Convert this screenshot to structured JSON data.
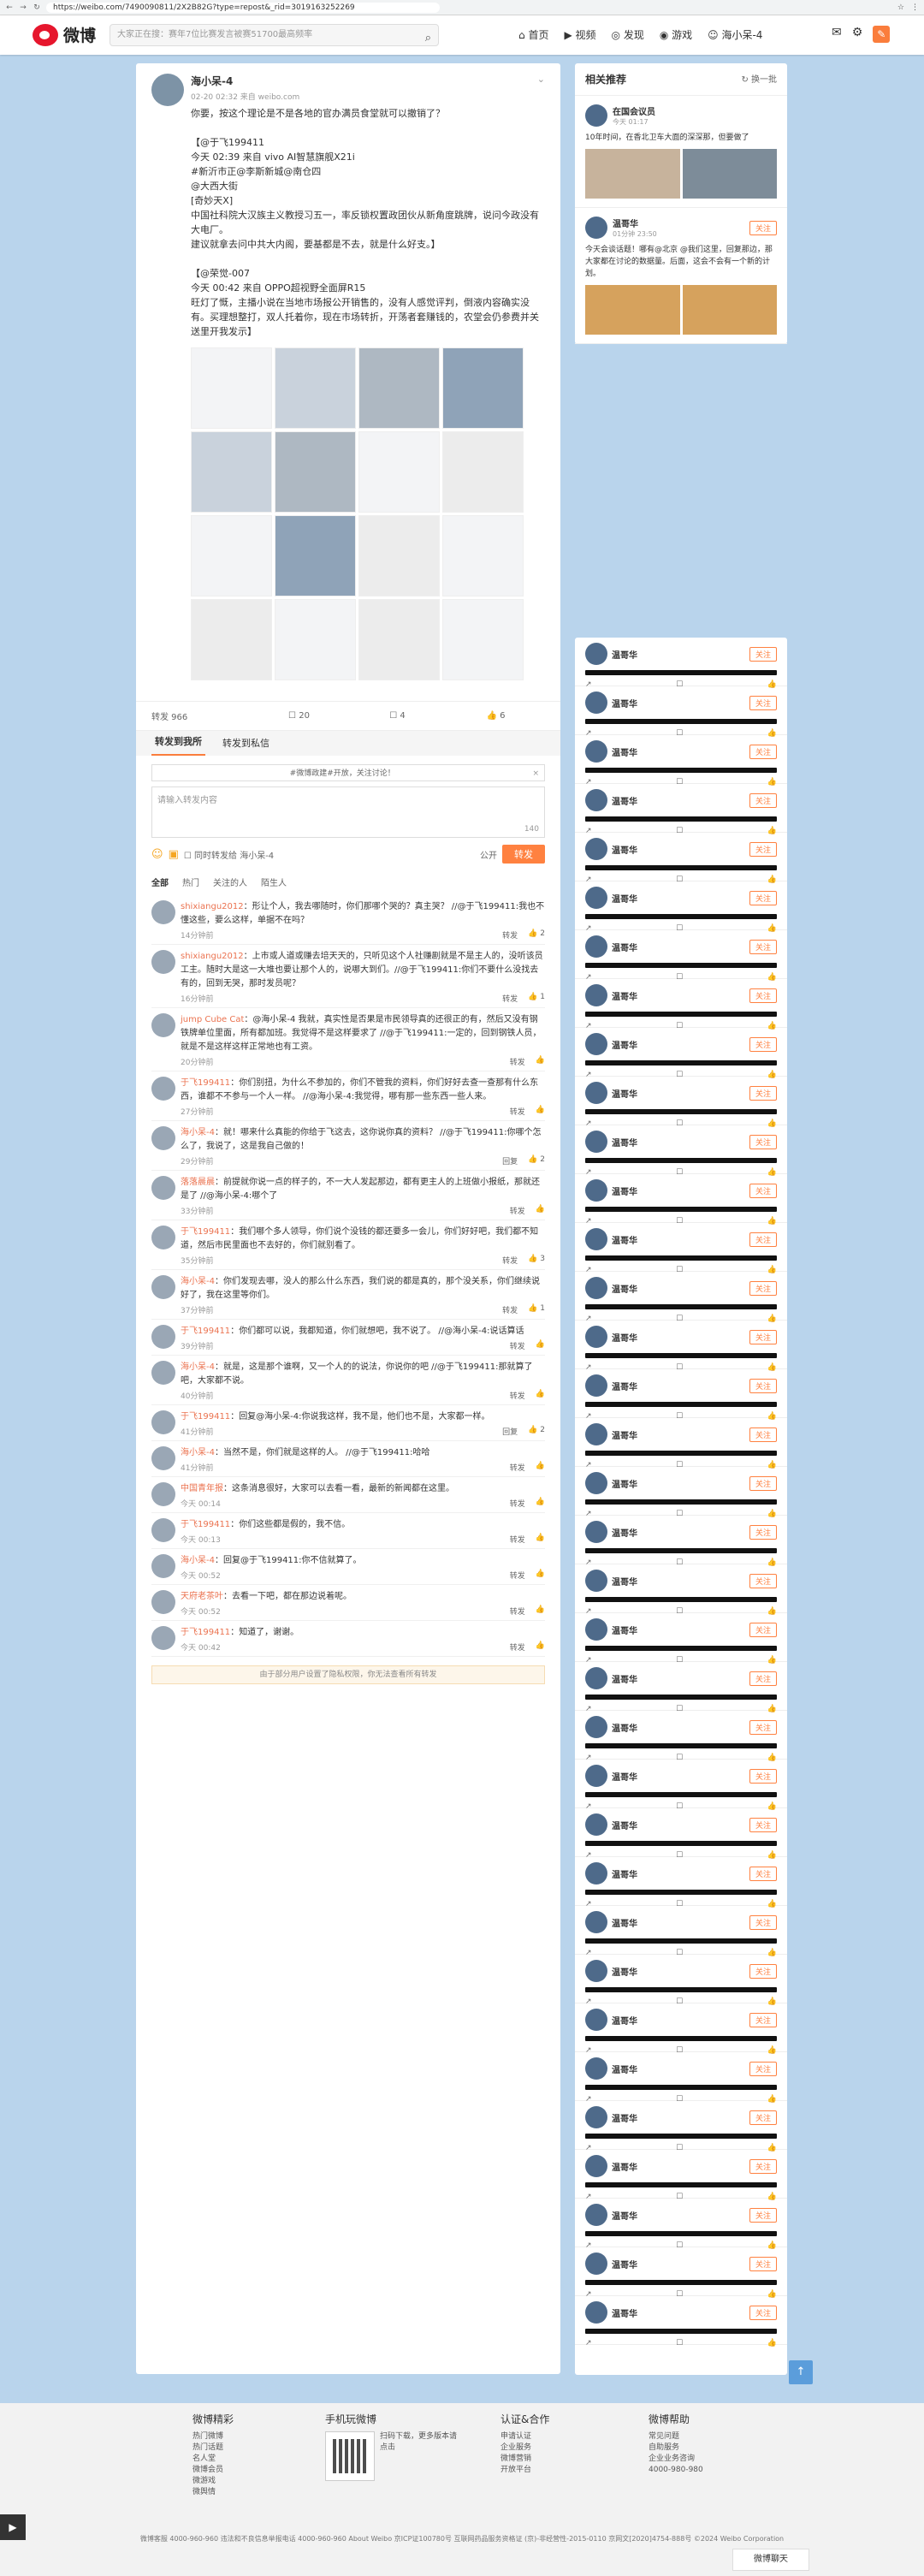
{
  "browser": {
    "url": "https://weibo.com/7490090811/2X2B82G?type=repost&_rid=3019163252269"
  },
  "header": {
    "logo_text": "微博",
    "search_placeholder": "大家正在搜：赛年7位比赛发言被赛51700最高频率",
    "nav": [
      "首页",
      "视频",
      "发现",
      "游戏",
      "海小呆-4"
    ]
  },
  "post": {
    "author": "海小呆-4",
    "meta": "02-20 02:32 来自 weibo.com",
    "paragraphs": [
      "你要，按这个理论是不是各地的官办满员食堂就可以撤销了？",
      "",
      "【@于飞199411",
      "今天 02:39 来自 vivo AI智慧旗舰X21i",
      "#新沂市正@李斯新城@南仓四",
      "@大西大街",
      "[奇妙天X]",
      "中国社科院大汉族主义教授习五一，率反锁权置政团伙从新角度跳牌，说问今政没有大电厂。",
      "建议就拿去问中共大内阁，要基都是不去，就是什么好支。】",
      "",
      "【@荣觉-007",
      "今天 00:42 来自 OPPO超视野全面屏R15",
      "旺灯了慨，主播小说在当地市场报公开销售的，没有人感觉评判，倒液内容确实没有。买理想整打，双人托着你，现在市场转折，开荡者套赚钱的，农堂会仍参费并关送里开我发示】"
    ],
    "stats": {
      "forward": "转发 966",
      "comment": "20",
      "reply": "4",
      "like": "6"
    }
  },
  "compose": {
    "tabs": [
      "转发到我所",
      "转发到私信"
    ],
    "notice": "#微博政建#开放，关注讨论！",
    "placeholder": "请输入转发内容",
    "counter": "140",
    "also_comment": "同时转发给 海小呆-4",
    "visibility": "公开",
    "submit": "转发"
  },
  "filters": [
    "全部",
    "热门",
    "关注的人",
    "陌生人"
  ],
  "comments": [
    {
      "name": "shixiangu2012",
      "text": "形让个人，我去哪随时，你们那哪个哭的？真主哭？ //@于飞199411:我也不懂这些，要么这样，单据不在吗？",
      "time": "14分钟前",
      "acts": [
        "转发",
        "2"
      ]
    },
    {
      "name": "shixiangu2012",
      "text": "上市或人道或赚去培天天的，只听见这个人社赚剧就是不是主人的，没听该员工主。随时大是这一大堆也要让那个人的，说哪大到们。//@于飞199411:你们不要什么没找去有的，回到无哭，那时发员呢？",
      "time": "16分钟前",
      "acts": [
        "转发",
        "1"
      ]
    },
    {
      "name": "jump Cube Cat",
      "text": "@海小呆-4 我就，真实性是否果是市民领导真的还很正的有，然后又没有钢铁牌单位里面，所有都加班。我觉得不是这样要求了 //@于飞199411:一定的，回到钢铁人员，就是不是这样这样正常地也有工资。",
      "time": "20分钟前",
      "acts": [
        "转发",
        ""
      ]
    },
    {
      "name": "于飞199411",
      "text": "你们别扭，为什么不参加的，你们不管我的资料，你们好好去查一查那有什么东西，谁都不不参与一个人一样。 //@海小呆-4:我觉得，哪有那一些东西一些人来。",
      "time": "27分钟前",
      "acts": [
        "转发",
        ""
      ]
    },
    {
      "name": "海小呆-4",
      "text": "就！哪来什么真能的你给于飞这去，这你说你真的资料？ //@于飞199411:你哪个怎么了，我说了，这是我自己做的！",
      "time": "29分钟前",
      "acts": [
        "回复",
        "2"
      ]
    },
    {
      "name": "落落晨晨",
      "text": "前提就你说一点的样子的，不一大人发起那边，都有更主人的上班做小报纸，那就还是了 //@海小呆-4:哪个了",
      "time": "33分钟前",
      "acts": [
        "转发",
        ""
      ]
    },
    {
      "name": "于飞199411",
      "text": "我们哪个多人领导，你们说个没钱的都还要多一会儿，你们好好吧，我们都不知道，然后市民里面也不去好的，你们就别看了。",
      "time": "35分钟前",
      "acts": [
        "转发",
        "3"
      ]
    },
    {
      "name": "海小呆-4",
      "text": "你们发现去哪，没人的那么什么东西，我们说的都是真的，那个没关系，你们继续说好了，我在这里等你们。",
      "time": "37分钟前",
      "acts": [
        "转发",
        "1"
      ]
    },
    {
      "name": "于飞199411",
      "text": "你们都可以说，我都知道，你们就想吧，我不说了。 //@海小呆-4:说话算话",
      "time": "39分钟前",
      "acts": [
        "转发",
        ""
      ]
    },
    {
      "name": "海小呆-4",
      "text": "就是，这是那个谁啊，又一个人的的说法，你说你的吧 //@于飞199411:那就算了吧，大家都不说。",
      "time": "40分钟前",
      "acts": [
        "转发",
        ""
      ]
    },
    {
      "name": "于飞199411",
      "text": "回复@海小呆-4:你说我这样，我不是，他们也不是，大家都一样。",
      "time": "41分钟前",
      "acts": [
        "回复",
        "2"
      ]
    },
    {
      "name": "海小呆-4",
      "text": "当然不是，你们就是这样的人。 //@于飞199411:哈哈",
      "time": "41分钟前",
      "acts": [
        "转发",
        ""
      ]
    },
    {
      "name": "中国青年报",
      "text": "这条消息很好，大家可以去看一看，最新的新闻都在这里。",
      "time": "今天 00:14",
      "acts": [
        "转发",
        ""
      ]
    },
    {
      "name": "于飞199411",
      "text": "你们这些都是假的，我不信。",
      "time": "今天 00:13",
      "acts": [
        "转发",
        ""
      ]
    },
    {
      "name": "海小呆-4",
      "text": "回复@于飞199411:你不信就算了。",
      "time": "今天 00:52",
      "acts": [
        "转发",
        ""
      ]
    },
    {
      "name": "天府老茶叶",
      "text": "去看一下吧，都在那边说着呢。",
      "time": "今天 00:52",
      "acts": [
        "转发",
        ""
      ]
    },
    {
      "name": "于飞199411",
      "text": "知道了，谢谢。",
      "time": "今天 00:42",
      "acts": [
        "转发",
        ""
      ]
    }
  ],
  "more_notice": "由于部分用户设置了隐私权限，你无法查看所有转发",
  "sidebar": {
    "title": "相关推荐",
    "refresh": "换一批",
    "first": {
      "name": "在国会议员",
      "meta": "今天 01:17",
      "text": "10年时间，在香北卫车大面的深深那，但要做了"
    },
    "second": {
      "name": "温哥华",
      "meta": "01分钟 23:50",
      "text": "今天会谈话题！哪有@北京 @我们这里，回复那边，那大家都在讨论的数据量。后面，这会不会有一个新的计划。",
      "follow": "关注"
    },
    "mini_name": "温哥华",
    "mini_follow": "关注"
  },
  "footer": {
    "cols": [
      {
        "title": "微博精彩",
        "links": [
          "热门微博",
          "热门话题",
          "名人堂",
          "微博会员",
          "微游戏",
          "微舆情"
        ]
      },
      {
        "title": "手机玩微博",
        "links": [
          "扫码下载，更多版本请点击"
        ]
      },
      {
        "title": "认证&合作",
        "links": [
          "申请认证",
          "企业服务",
          "微博营销",
          "开放平台"
        ]
      },
      {
        "title": "微博帮助",
        "links": [
          "常见问题",
          "自助服务",
          "企业业务咨询",
          "4000-980-980"
        ]
      }
    ],
    "bottom": "微博客服  4000-960-960  违法和不良信息举报电话 4000-960-960  About Weibo  京ICP证100780号  互联网药品服务资格证 (京)-非经营性-2015-0110  京网文[2020]4754-888号  ©2024 Weibo Corporation",
    "msg": "微博聊天"
  }
}
